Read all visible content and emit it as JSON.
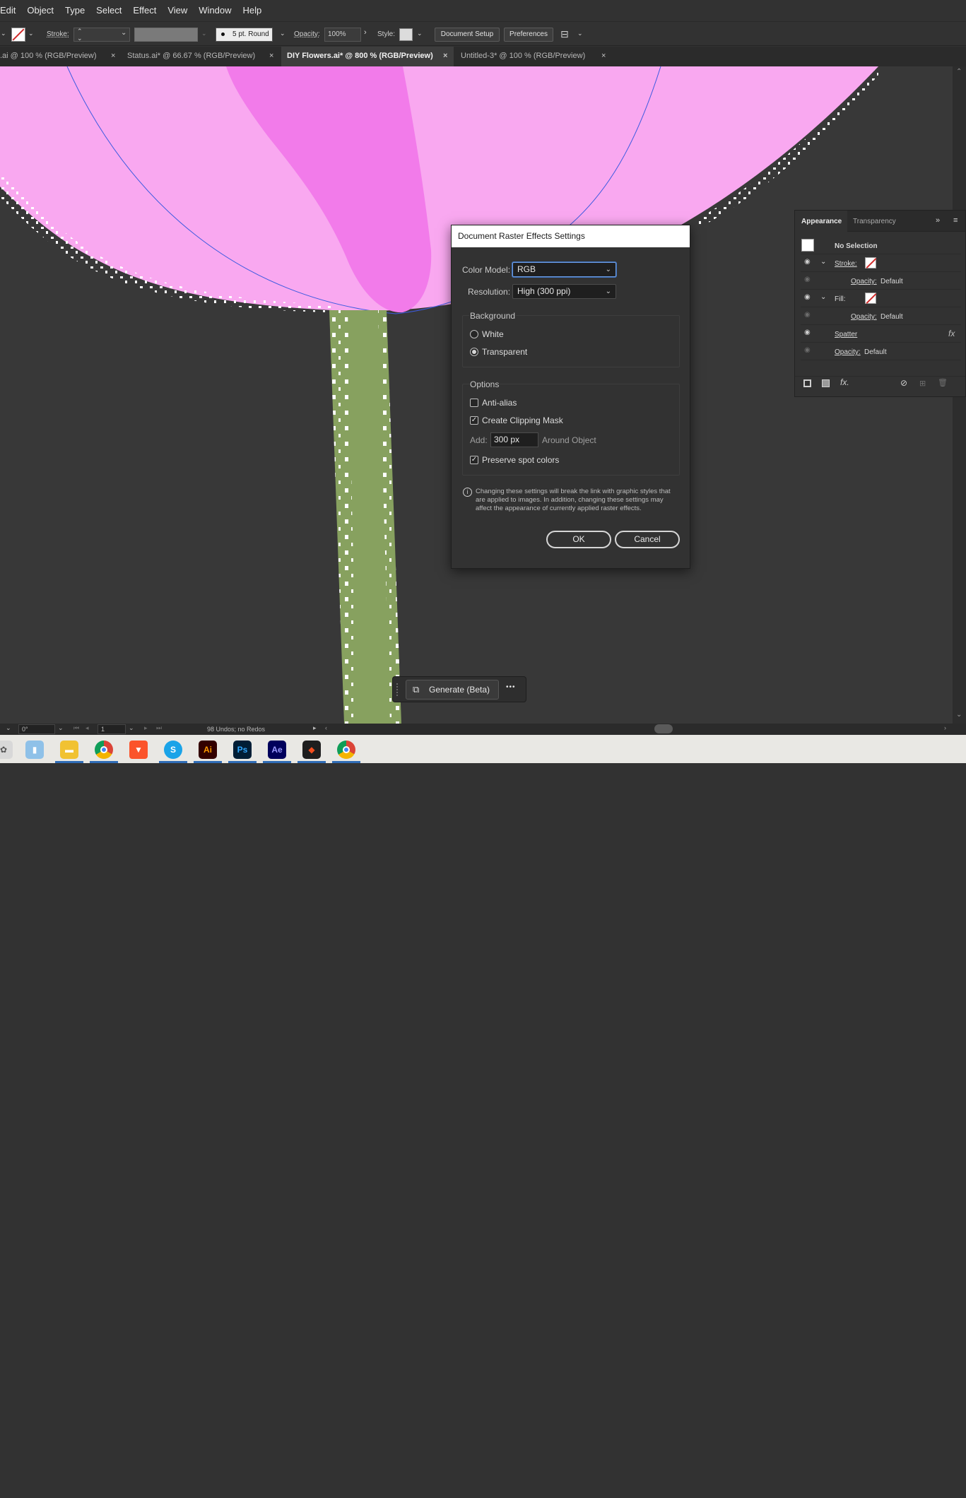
{
  "menu": [
    "Edit",
    "Object",
    "Type",
    "Select",
    "Effect",
    "View",
    "Window",
    "Help"
  ],
  "control": {
    "stroke_label": "Stroke:",
    "brush_label": "5 pt. Round",
    "opacity_label": "Opacity:",
    "opacity_value": "100%",
    "style_label": "Style:",
    "document_setup": "Document Setup",
    "preferences": "Preferences"
  },
  "tabs": [
    {
      "label": ".ai @ 100 % (RGB/Preview)",
      "active": false
    },
    {
      "label": "Status.ai* @ 66.67 % (RGB/Preview)",
      "active": false
    },
    {
      "label": "DIY Flowers.ai* @ 800 % (RGB/Preview)",
      "active": true
    },
    {
      "label": "Untitled-3* @ 100 % (RGB/Preview)",
      "active": false
    }
  ],
  "close_glyph": "×",
  "colors": {
    "pink_light": "#f9a8f0",
    "pink_dark": "#f27bea",
    "stem_green": "#87a15f",
    "guide_blue": "#3d5be0",
    "canvas_bg": "#383838"
  },
  "dialog": {
    "title": "Document Raster Effects Settings",
    "color_model_label": "Color Model:",
    "color_model_value": "RGB",
    "resolution_label": "Resolution:",
    "resolution_value": "High (300 ppi)",
    "background_group": "Background",
    "bg_white": "White",
    "bg_transparent": "Transparent",
    "options_group": "Options",
    "anti_alias": "Anti-alias",
    "anti_alias_checked": false,
    "clipping_mask": "Create Clipping Mask",
    "clipping_mask_checked": true,
    "add_label": "Add:",
    "add_value": "300 px",
    "around_object": "Around Object",
    "preserve_spot": "Preserve spot colors",
    "preserve_spot_checked": true,
    "info_text": "Changing these settings will break the link with graphic styles that are applied to images. In addition, changing these settings may affect the appearance of currently applied raster effects.",
    "ok": "OK",
    "cancel": "Cancel"
  },
  "appearance": {
    "tab_appearance": "Appearance",
    "tab_transparency": "Transparency",
    "no_selection": "No Selection",
    "stroke": "Stroke:",
    "fill": "Fill:",
    "opacity_label": "Opacity:",
    "opacity_value": "Default",
    "spatter": "Spatter",
    "fx": "fx"
  },
  "status": {
    "rotation": "0°",
    "artboard": "1",
    "undo_text": "98 Undos; no Redos"
  },
  "generate": {
    "label": "Generate (Beta)",
    "more": "•••"
  },
  "taskbar": {
    "apps": [
      "Ai",
      "Ps",
      "Ae"
    ]
  }
}
